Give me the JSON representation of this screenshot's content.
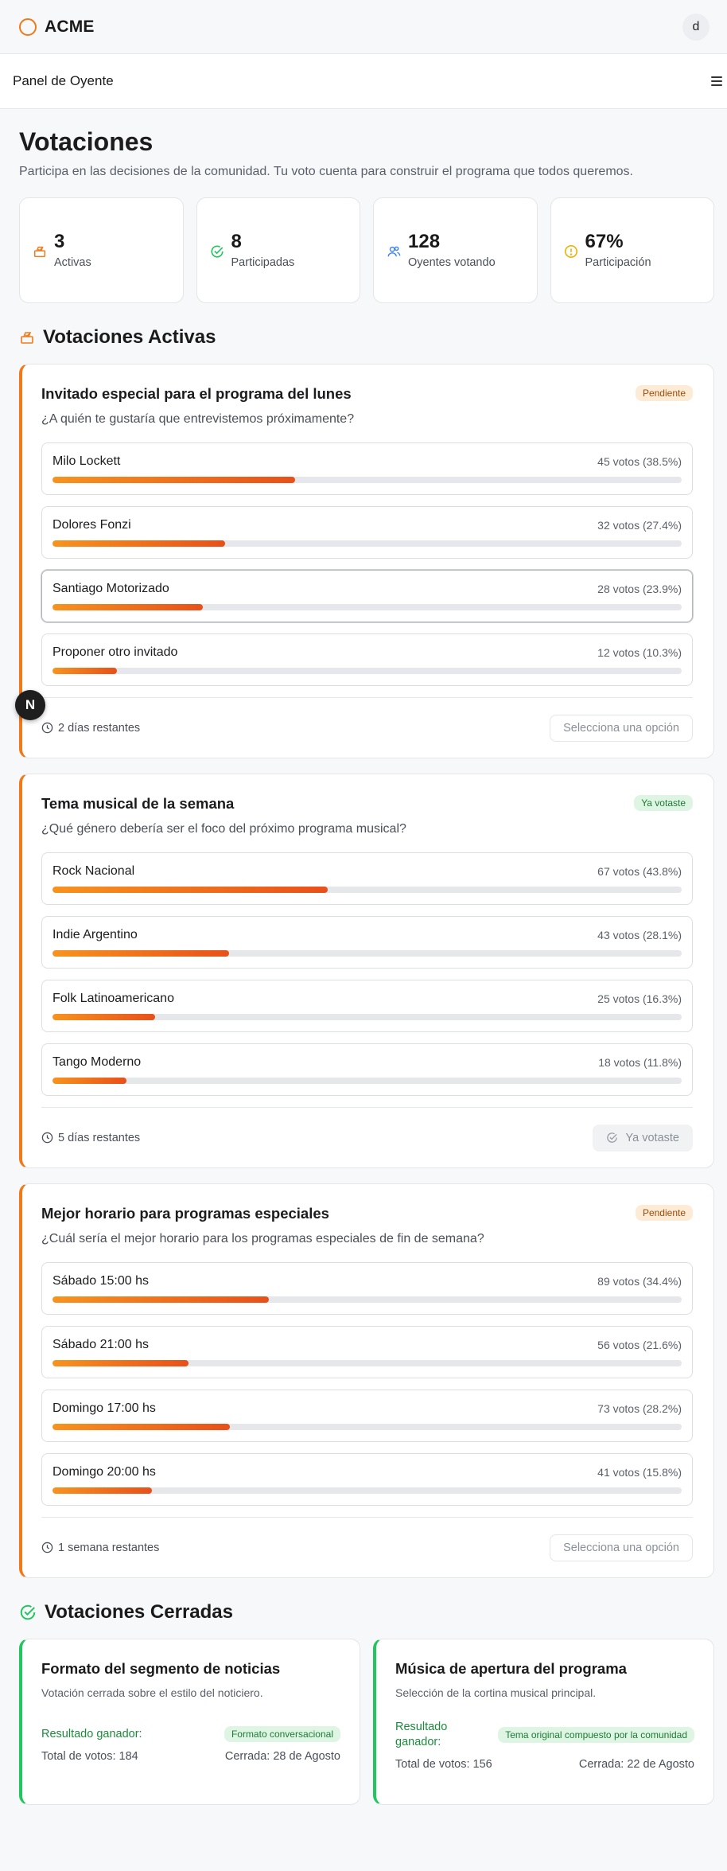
{
  "header": {
    "logo": "ACME",
    "avatar_letter": "d"
  },
  "subheader": {
    "title": "Panel de Oyente"
  },
  "page": {
    "title": "Votaciones",
    "subtitle": "Participa en las decisiones de la comunidad. Tu voto cuenta para construir el programa que todos queremos."
  },
  "stats": [
    {
      "icon": "ballot-box-icon",
      "value": "3",
      "label": "Activas",
      "color": "#f07a1a"
    },
    {
      "icon": "check-circle-icon",
      "value": "8",
      "label": "Participadas",
      "color": "#22c55e"
    },
    {
      "icon": "users-icon",
      "value": "128",
      "label": "Oyentes votando",
      "color": "#3b82f6"
    },
    {
      "icon": "alert-circle-icon",
      "value": "67%",
      "label": "Participación",
      "color": "#eab308"
    }
  ],
  "active_section": {
    "title": "Votaciones Activas"
  },
  "polls": [
    {
      "title": "Invitado especial para el programa del lunes",
      "status": "Pendiente",
      "question": "¿A quién te gustaría que entrevistemos próximamente?",
      "options": [
        {
          "label": "Milo Lockett",
          "votes": "45 votos (38.5%)",
          "pct": 38.5
        },
        {
          "label": "Dolores Fonzi",
          "votes": "32 votos (27.4%)",
          "pct": 27.4
        },
        {
          "label": "Santiago Motorizado",
          "votes": "28 votos (23.9%)",
          "pct": 23.9
        },
        {
          "label": "Proponer otro invitado",
          "votes": "12 votos (10.3%)",
          "pct": 10.3
        }
      ],
      "remaining": "2 días restantes",
      "action": "Selecciona una opción"
    },
    {
      "title": "Tema musical de la semana",
      "status": "Ya votaste",
      "question": "¿Qué género debería ser el foco del próximo programa musical?",
      "options": [
        {
          "label": "Rock Nacional",
          "votes": "67 votos (43.8%)",
          "pct": 43.8
        },
        {
          "label": "Indie Argentino",
          "votes": "43 votos (28.1%)",
          "pct": 28.1
        },
        {
          "label": "Folk Latinoamericano",
          "votes": "25 votos (16.3%)",
          "pct": 16.3
        },
        {
          "label": "Tango Moderno",
          "votes": "18 votos (11.8%)",
          "pct": 11.8
        }
      ],
      "remaining": "5 días restantes",
      "action": "Ya votaste"
    },
    {
      "title": "Mejor horario para programas especiales",
      "status": "Pendiente",
      "question": "¿Cuál sería el mejor horario para los programas especiales de fin de semana?",
      "options": [
        {
          "label": "Sábado 15:00 hs",
          "votes": "89 votos (34.4%)",
          "pct": 34.4
        },
        {
          "label": "Sábado 21:00 hs",
          "votes": "56 votos (21.6%)",
          "pct": 21.6
        },
        {
          "label": "Domingo 17:00 hs",
          "votes": "73 votos (28.2%)",
          "pct": 28.2
        },
        {
          "label": "Domingo 20:00 hs",
          "votes": "41 votos (15.8%)",
          "pct": 15.8
        }
      ],
      "remaining": "1 semana restantes",
      "action": "Selecciona una opción"
    }
  ],
  "fab": {
    "letter": "N"
  },
  "closed_section": {
    "title": "Votaciones Cerradas"
  },
  "closed": [
    {
      "title": "Formato del segmento de noticias",
      "desc": "Votación cerrada sobre el estilo del noticiero.",
      "result_label": "Resultado ganador:",
      "result": "Formato conversacional",
      "total": "Total de votos: 184",
      "closed_on": "Cerrada: 28 de Agosto"
    },
    {
      "title": "Música de apertura del programa",
      "desc": "Selección de la cortina musical principal.",
      "result_label": "Resultado ganador:",
      "result": "Tema original compuesto por la comunidad",
      "total": "Total de votos: 156",
      "closed_on": "Cerrada: 22 de Agosto"
    }
  ]
}
